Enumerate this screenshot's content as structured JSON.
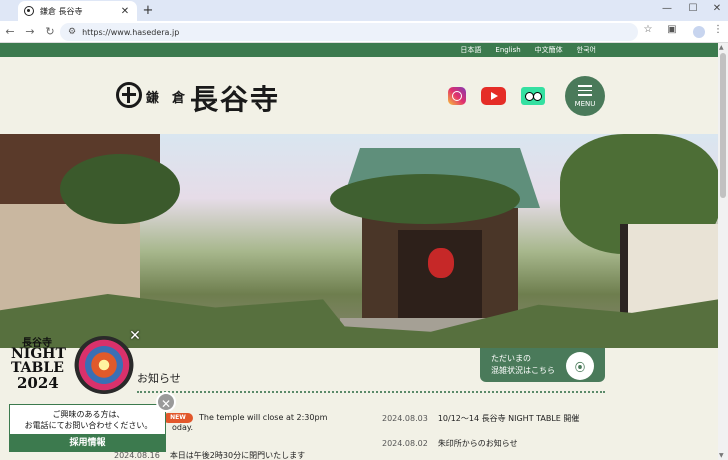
{
  "browser": {
    "tab_title": "鎌倉 長谷寺",
    "tab_close": "✕",
    "new_tab": "+",
    "url": "https://www.hasedera.jp",
    "minimize": "—",
    "maximize": "☐",
    "close": "✕"
  },
  "languages": [
    "日本語",
    "English",
    "中文簡体",
    "한국어"
  ],
  "header": {
    "logo_small_1": "鎌",
    "logo_small_2": "倉",
    "logo_big": "長谷寺",
    "menu_label": "MENU"
  },
  "crowd": {
    "line1": "ただいまの",
    "line2": "混雑状況はこちら"
  },
  "news": {
    "title": "お知らせ",
    "new_badge": "NEW",
    "items": [
      {
        "date": "",
        "text": "The temple will close at 2:30pm"
      },
      {
        "date": "2024.08.03",
        "text": "10/12～14 長谷寺 NIGHT TABLE 開催"
      },
      {
        "date": "2024.08.02",
        "text": "朱印所からのお知らせ"
      },
      {
        "date": "2024.08.16",
        "text": "本日は午後2時30分に閉門いたします"
      }
    ],
    "today_fragment": "oday."
  },
  "night_table": {
    "small": "長谷寺",
    "line1": "NIGHT",
    "line2": "TABLE",
    "line3": "2024",
    "close": "✕"
  },
  "popup": {
    "line1": "ご興味のある方は、",
    "line2": "お電話にてお問い合わせください。",
    "button": "採用情報",
    "close": "✕"
  },
  "colors": {
    "brand_green": "#3c7a4e",
    "menu_green": "#4a7a5a",
    "new_orange": "#e2572b",
    "page_bg": "#f2f1e6"
  }
}
